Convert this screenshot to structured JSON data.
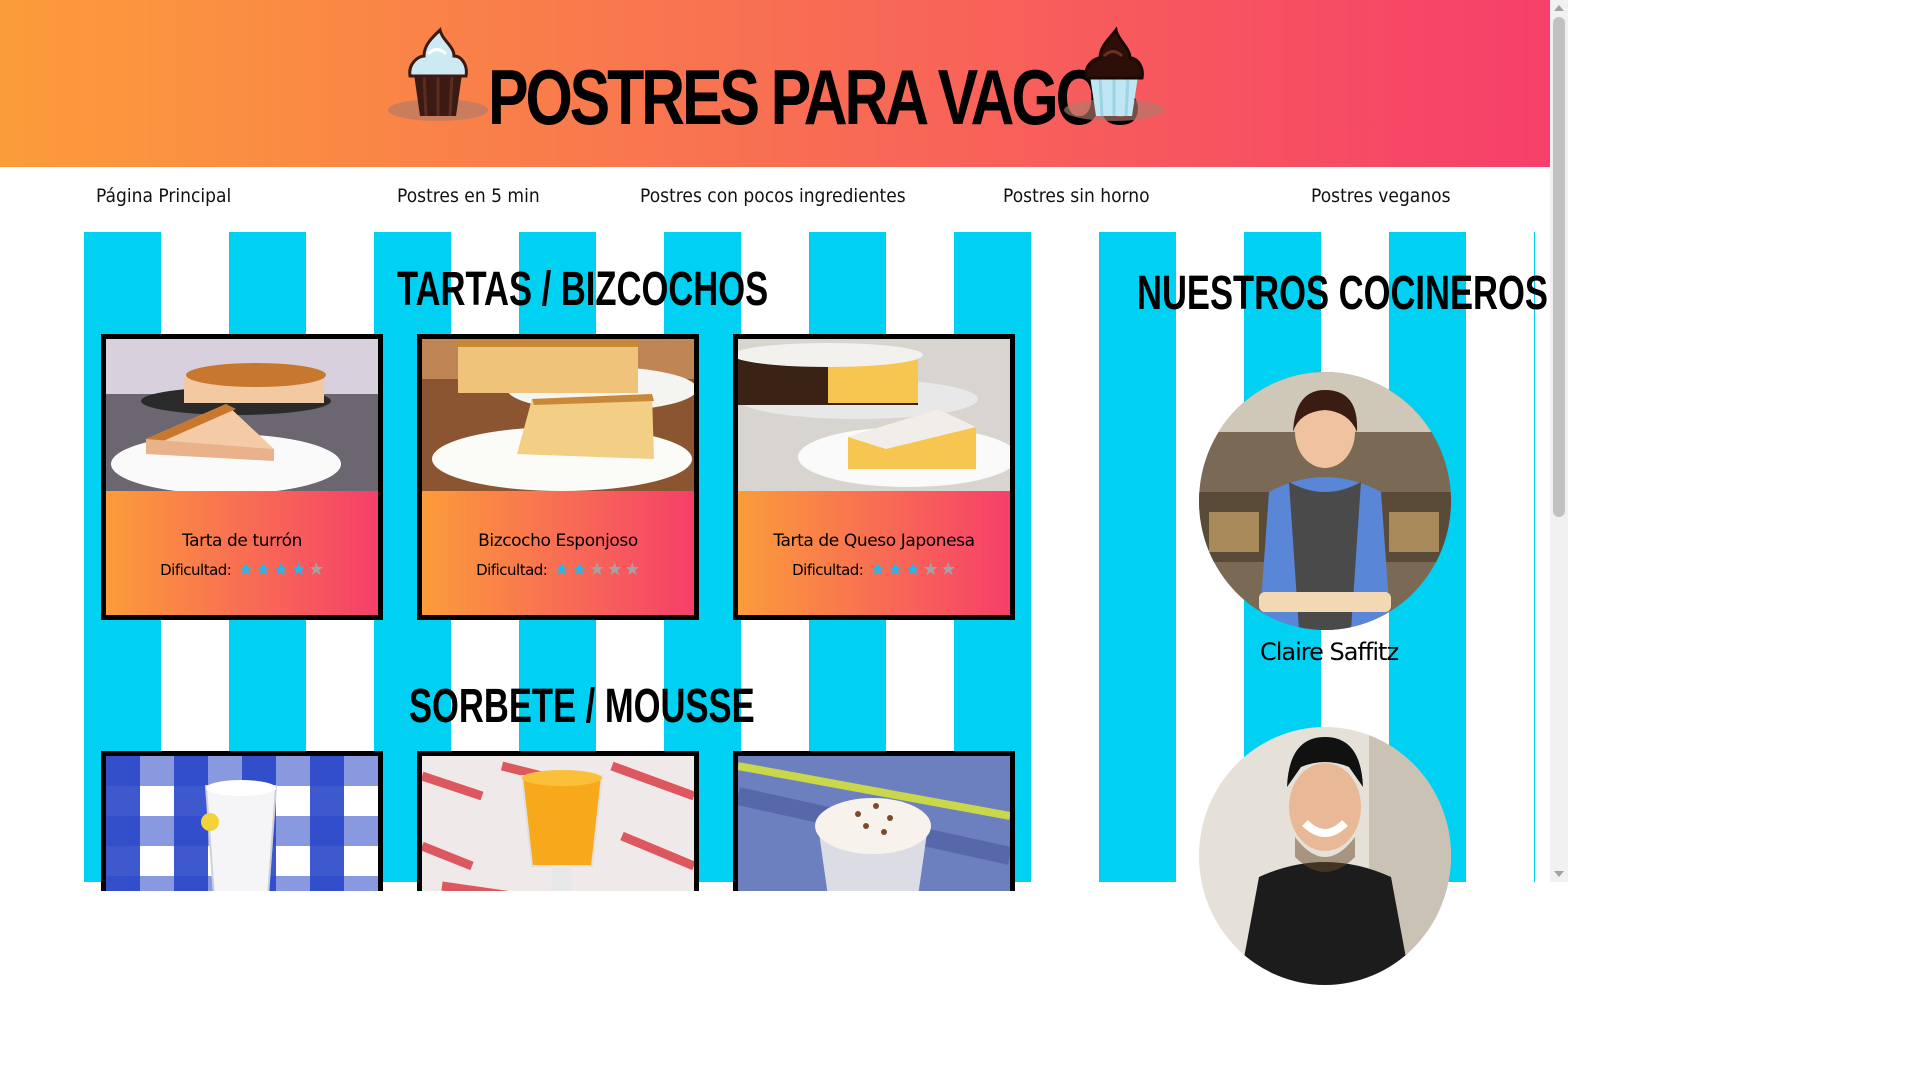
{
  "header": {
    "title": "POSTRES PARA VAGOS"
  },
  "nav": {
    "items": [
      {
        "label": "Página Principal"
      },
      {
        "label": "Postres en 5 min"
      },
      {
        "label": "Postres con pocos ingredientes"
      },
      {
        "label": "Postres sin horno"
      },
      {
        "label": "Postres veganos"
      }
    ]
  },
  "sections": [
    {
      "title": "TARTAS / BIZCOCHOS",
      "cards": [
        {
          "title": "Tarta de turrón",
          "difficulty_label": "Dificultad:",
          "rating": 4,
          "max": 5
        },
        {
          "title": "Bizcocho Esponjoso",
          "difficulty_label": "Dificultad:",
          "rating": 2,
          "max": 5
        },
        {
          "title": "Tarta de Queso Japonesa",
          "difficulty_label": "Dificultad:",
          "rating": 3,
          "max": 5
        }
      ]
    },
    {
      "title": "SORBETE / MOUSSE"
    }
  ],
  "chefs": {
    "title": "NUESTROS COCINEROS",
    "items": [
      {
        "name": "Claire Saffitz"
      }
    ]
  },
  "colors": {
    "gradient_start": "#fb9c3a",
    "gradient_end": "#f63f6a",
    "stripe": "#00d1f2",
    "star_on": "#1fb9f0",
    "star_off": "#a3a3a3"
  },
  "icons": [
    "cupcake-vanilla-icon",
    "cupcake-chocolate-icon",
    "star-icon"
  ]
}
